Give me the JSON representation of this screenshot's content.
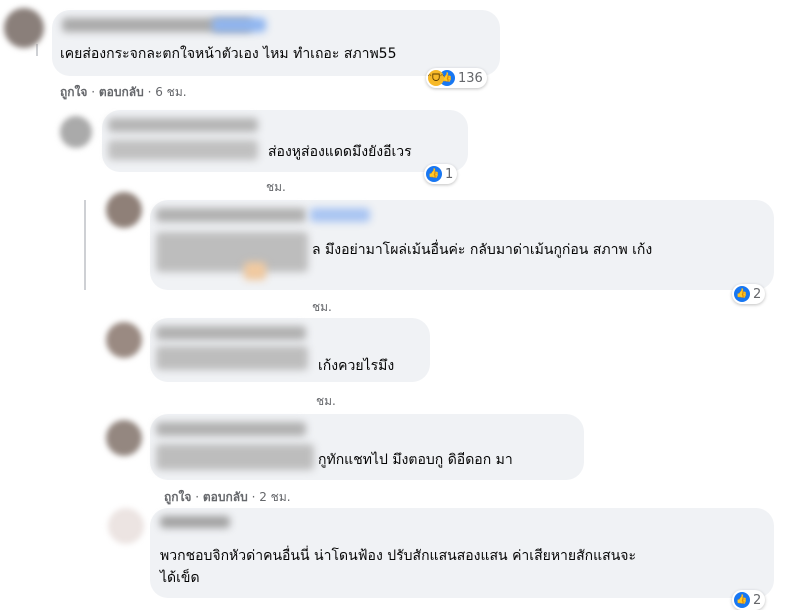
{
  "comments": [
    {
      "text": "เคยส่องกระจกละตกใจหน้าตัวเอง ไหม ทำเถอะ สภาพ55",
      "like": "ถูกใจ",
      "reply": "ตอบกลับ",
      "time": "6 ชม.",
      "reaction_count": "136"
    },
    {
      "text": "ส่องหูส่องแดดมึงยังอีเวร",
      "time": "ชม.",
      "reaction_count": "1"
    },
    {
      "text": "มึงอย่ามาโผล่เม้นอื่นค่ะ กลับมาด่าเม้นกูก่อน สภาพ เก้ง",
      "text_prefix": "ล",
      "time": "ชม.",
      "reaction_count": "2"
    },
    {
      "text": "เก้งควยไรมึง",
      "time": "ชม."
    },
    {
      "text": "กูทักแชทไป มึงตอบกู ดิอีดอก มา",
      "like": "ถูกใจ",
      "reply": "ตอบกลับ",
      "time": "2 ชม."
    },
    {
      "text_line1": "พวกชอบจิกหัวด่าคนอื่นนี่ น่าโดนฟ้อง ปรับสักแสนสองแสน ค่าเสียหายสักแสนจะ",
      "text_line2": "ได้เข็ด",
      "reaction_count": "2"
    }
  ],
  "icons": {
    "like": "like-icon",
    "haha": "haha-icon"
  },
  "colors": {
    "bubble": "#f0f2f5",
    "like_blue": "#1877f2",
    "meta": "#65676b"
  }
}
